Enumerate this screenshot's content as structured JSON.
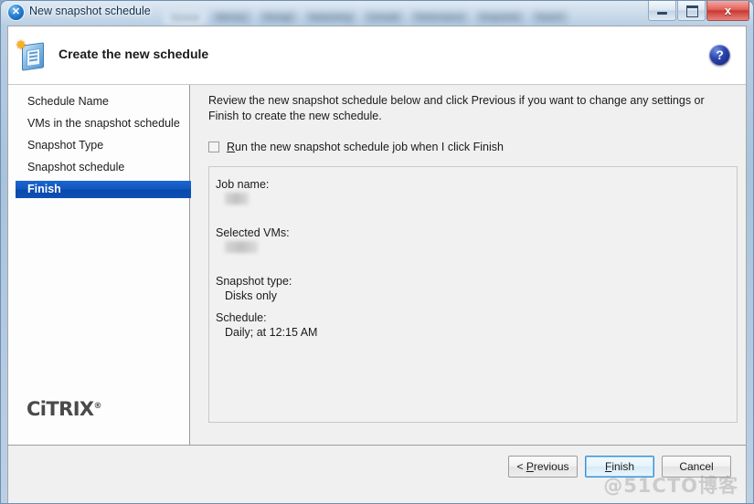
{
  "window": {
    "title": "New snapshot schedule",
    "title_icon": "x-circle-icon",
    "controls": {
      "minimize": "minimize-icon",
      "maximize": "maximize-icon",
      "close": "x"
    },
    "background_tabs": [
      "General",
      "Memory",
      "Storage",
      "Networking",
      "Console",
      "Performance",
      "Snapshots",
      "Search"
    ]
  },
  "header": {
    "title": "Create the new schedule",
    "icon": "new-schedule-icon",
    "help_label": "?"
  },
  "sidebar": {
    "items": [
      {
        "label": "Schedule Name",
        "active": false
      },
      {
        "label": "VMs in the snapshot schedule",
        "active": false
      },
      {
        "label": "Snapshot Type",
        "active": false
      },
      {
        "label": "Snapshot schedule",
        "active": false
      },
      {
        "label": "Finish",
        "active": true
      }
    ],
    "logo": "CiTRIX"
  },
  "main": {
    "intro": "Review the new snapshot schedule below and click Previous if you want to change any settings or Finish to create the new schedule.",
    "run_checkbox": {
      "checked": false,
      "label_prefix": "",
      "label_accel": "R",
      "label_rest": "un the new snapshot schedule job when I click Finish"
    },
    "summary": [
      {
        "label": "Job name:",
        "value": "",
        "redacted": true,
        "redact_width": "narrow"
      },
      {
        "label": "Selected VMs:",
        "value": "",
        "redacted": true,
        "redact_width": "wide"
      },
      {
        "label": "Snapshot type:",
        "value": "Disks only",
        "redacted": false
      },
      {
        "label": "Schedule:",
        "value": "Daily; at 12:15 AM",
        "redacted": false
      }
    ]
  },
  "footer": {
    "previous": {
      "prefix": "< ",
      "accel": "P",
      "rest": "revious"
    },
    "finish": {
      "accel": "F",
      "rest": "inish"
    },
    "cancel": "Cancel"
  },
  "watermark": "@51CTO博客"
}
